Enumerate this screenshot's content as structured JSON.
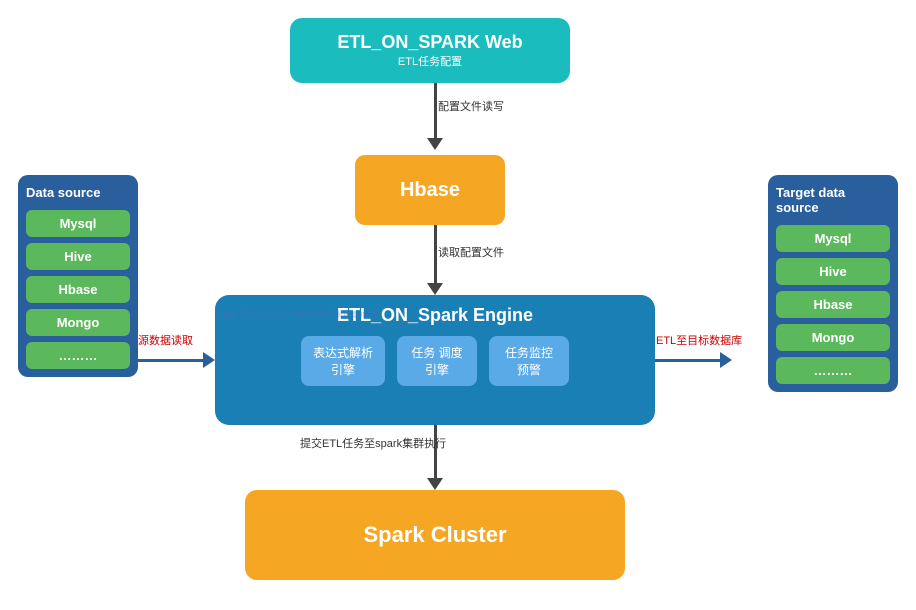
{
  "etl_web": {
    "title": "ETL_ON_SPARK Web",
    "subtitle": "ETL任务配置"
  },
  "hbase": {
    "title": "Hbase"
  },
  "spark_engine": {
    "title": "ETL_ON_Spark Engine",
    "modules": [
      "表达式解析\n引擎",
      "任务 调度\n引擎",
      "任务监控\n预警"
    ]
  },
  "spark_cluster": {
    "title": "Spark Cluster"
  },
  "data_source_left": {
    "title": "Data source",
    "items": [
      "Mysql",
      "Hive",
      "Hbase",
      "Mongo",
      "………"
    ]
  },
  "data_source_right": {
    "title": "Target data source",
    "items": [
      "Mysql",
      "Hive",
      "Hbase",
      "Mongo",
      "………"
    ]
  },
  "arrows": {
    "config_rw": "配置文件读写",
    "read_config": "读取配置文件",
    "source_read": "源数据读取",
    "etl_to_target": "ETL至目标数据库",
    "submit_task": "提交ETL任务至spark集群执行"
  },
  "watermark": "http://blog.csdn.net/zhe1090549839"
}
